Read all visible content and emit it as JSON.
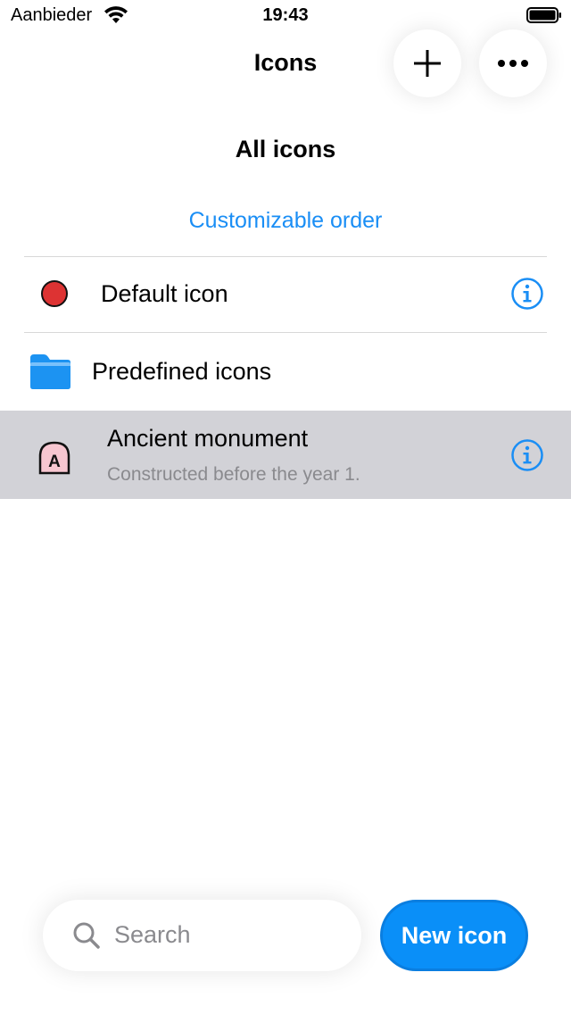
{
  "status_bar": {
    "carrier": "Aanbieder",
    "time": "19:43"
  },
  "nav": {
    "title": "Icons",
    "add_icon": "plus-icon",
    "more_icon": "ellipsis-icon"
  },
  "section": {
    "title": "All icons",
    "order_link": "Customizable order"
  },
  "rows": [
    {
      "label": "Default icon",
      "icon": "red-dot-icon",
      "has_info": true
    },
    {
      "label": "Predefined icons",
      "icon": "folder-icon",
      "has_info": false
    },
    {
      "label": "Ancient monument",
      "subtitle": "Constructed before the year 1.",
      "icon": "monument-icon",
      "icon_letter": "A",
      "has_info": true,
      "selected": true
    }
  ],
  "bottom": {
    "search_placeholder": "Search",
    "new_button": "New icon"
  },
  "colors": {
    "accent": "#1a8ef5",
    "selected_row": "#d2d2d7",
    "red_dot": "#dd3333",
    "folder": "#1c93f2",
    "monument_fill": "#f7c6d0"
  }
}
